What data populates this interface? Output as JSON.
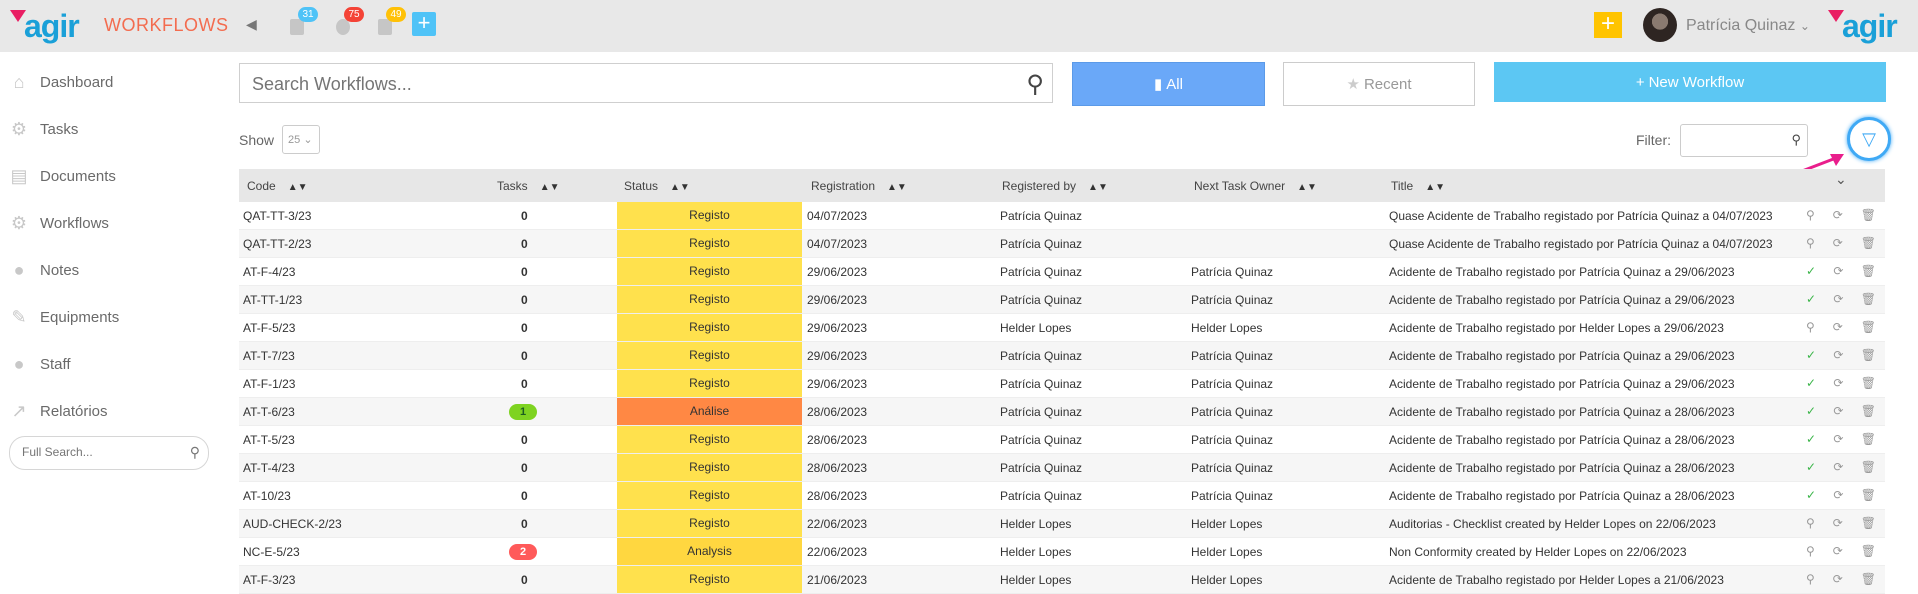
{
  "app": {
    "logo_text": "agir",
    "module_title": "WORKFLOWS",
    "user_name": "Patrícia Quinaz"
  },
  "top_icons": [
    {
      "name": "calendar-icon",
      "count": "31",
      "color": "#4fc3f7"
    },
    {
      "name": "gear-icon",
      "count": "75",
      "color": "#f44336"
    },
    {
      "name": "document-icon",
      "count": "49",
      "color": "#ffc107"
    }
  ],
  "sidebar": {
    "items": [
      {
        "label": "Dashboard",
        "icon": "home-icon"
      },
      {
        "label": "Tasks",
        "icon": "gear-icon"
      },
      {
        "label": "Documents",
        "icon": "document-icon"
      },
      {
        "label": "Workflows",
        "icon": "gears-icon"
      },
      {
        "label": "Notes",
        "icon": "chat-icon"
      },
      {
        "label": "Equipments",
        "icon": "wrench-icon"
      },
      {
        "label": "Staff",
        "icon": "user-icon"
      },
      {
        "label": "Relatórios",
        "icon": "chart-icon"
      }
    ],
    "full_search_placeholder": "Full Search..."
  },
  "toolbar": {
    "search_placeholder": "Search Workflows...",
    "all_label": "All",
    "recent_label": "Recent",
    "new_label": "New Workflow",
    "show_label": "Show",
    "page_size": "25",
    "filter_label": "Filter:"
  },
  "table": {
    "headers": {
      "code": "Code",
      "tasks": "Tasks",
      "status": "Status",
      "registration": "Registration",
      "registered_by": "Registered by",
      "next_owner": "Next Task Owner",
      "title": "Title"
    },
    "rows": [
      {
        "code": "QAT-TT-3/23",
        "tasks": "0",
        "status": "Registo",
        "registration": "04/07/2023",
        "registered_by": "Patrícia Quinaz",
        "next_owner": "",
        "title": "Quase Acidente de Trabalho registado por Patrícia Quinaz a 04/07/2023",
        "first_action": "search"
      },
      {
        "code": "QAT-TT-2/23",
        "tasks": "0",
        "status": "Registo",
        "registration": "04/07/2023",
        "registered_by": "Patrícia Quinaz",
        "next_owner": "",
        "title": "Quase Acidente de Trabalho registado por Patrícia Quinaz a 04/07/2023",
        "first_action": "search"
      },
      {
        "code": "AT-F-4/23",
        "tasks": "0",
        "status": "Registo",
        "registration": "29/06/2023",
        "registered_by": "Patrícia Quinaz",
        "next_owner": "Patrícia Quinaz",
        "title": "Acidente de Trabalho registado por Patrícia Quinaz a 29/06/2023",
        "first_action": "check"
      },
      {
        "code": "AT-TT-1/23",
        "tasks": "0",
        "status": "Registo",
        "registration": "29/06/2023",
        "registered_by": "Patrícia Quinaz",
        "next_owner": "Patrícia Quinaz",
        "title": "Acidente de Trabalho registado por Patrícia Quinaz a 29/06/2023",
        "first_action": "check"
      },
      {
        "code": "AT-F-5/23",
        "tasks": "0",
        "status": "Registo",
        "registration": "29/06/2023",
        "registered_by": "Helder Lopes",
        "next_owner": "Helder Lopes",
        "title": "Acidente de Trabalho registado por Helder Lopes a 29/06/2023",
        "first_action": "search"
      },
      {
        "code": "AT-T-7/23",
        "tasks": "0",
        "status": "Registo",
        "registration": "29/06/2023",
        "registered_by": "Patrícia Quinaz",
        "next_owner": "Patrícia Quinaz",
        "title": "Acidente de Trabalho registado por Patrícia Quinaz a 29/06/2023",
        "first_action": "check"
      },
      {
        "code": "AT-F-1/23",
        "tasks": "0",
        "status": "Registo",
        "registration": "29/06/2023",
        "registered_by": "Patrícia Quinaz",
        "next_owner": "Patrícia Quinaz",
        "title": "Acidente de Trabalho registado por Patrícia Quinaz a 29/06/2023",
        "first_action": "check"
      },
      {
        "code": "AT-T-6/23",
        "tasks": "1",
        "status": "Análise",
        "registration": "28/06/2023",
        "registered_by": "Patrícia Quinaz",
        "next_owner": "Patrícia Quinaz",
        "title": "Acidente de Trabalho registado por Patrícia Quinaz a 28/06/2023",
        "first_action": "check"
      },
      {
        "code": "AT-T-5/23",
        "tasks": "0",
        "status": "Registo",
        "registration": "28/06/2023",
        "registered_by": "Patrícia Quinaz",
        "next_owner": "Patrícia Quinaz",
        "title": "Acidente de Trabalho registado por Patrícia Quinaz a 28/06/2023",
        "first_action": "check"
      },
      {
        "code": "AT-T-4/23",
        "tasks": "0",
        "status": "Registo",
        "registration": "28/06/2023",
        "registered_by": "Patrícia Quinaz",
        "next_owner": "Patrícia Quinaz",
        "title": "Acidente de Trabalho registado por Patrícia Quinaz a 28/06/2023",
        "first_action": "check"
      },
      {
        "code": "AT-10/23",
        "tasks": "0",
        "status": "Registo",
        "registration": "28/06/2023",
        "registered_by": "Patrícia Quinaz",
        "next_owner": "Patrícia Quinaz",
        "title": "Acidente de Trabalho registado por Patrícia Quinaz a 28/06/2023",
        "first_action": "check"
      },
      {
        "code": "AUD-CHECK-2/23",
        "tasks": "0",
        "status": "Registo",
        "registration": "22/06/2023",
        "registered_by": "Helder Lopes",
        "next_owner": "Helder Lopes",
        "title": "Auditorias - Checklist created by Helder Lopes on 22/06/2023",
        "first_action": "search"
      },
      {
        "code": "NC-E-5/23",
        "tasks": "2",
        "status": "Analysis",
        "registration": "22/06/2023",
        "registered_by": "Helder Lopes",
        "next_owner": "Helder Lopes",
        "title": "Non Conformity created by Helder Lopes on 22/06/2023",
        "first_action": "search"
      },
      {
        "code": "AT-F-3/23",
        "tasks": "0",
        "status": "Registo",
        "registration": "21/06/2023",
        "registered_by": "Helder Lopes",
        "next_owner": "Helder Lopes",
        "title": "Acidente de Trabalho registado por Helder Lopes a 21/06/2023",
        "first_action": "search"
      }
    ]
  },
  "colors": {
    "registo": "#ffe14d",
    "analise": "#ff8844",
    "analysis": "#ffd740",
    "badge_green": "#7ed321",
    "badge_red": "#ff5a5a"
  }
}
